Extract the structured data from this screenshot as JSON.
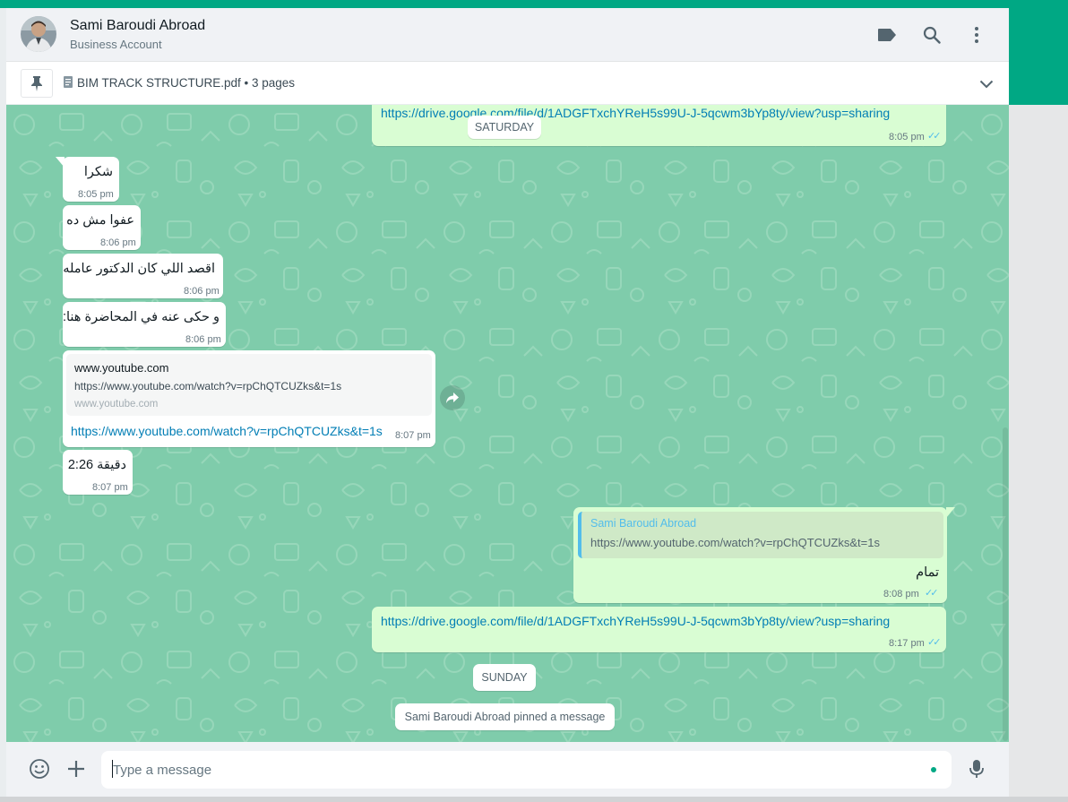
{
  "header": {
    "contact_name": "Sami Baroudi Abroad",
    "contact_subtitle": "Business Account",
    "icons": [
      "label-icon",
      "search-icon",
      "menu-icon"
    ]
  },
  "pinned": {
    "text": "BIM TRACK STRUCTURE.pdf • 3 pages",
    "icons": [
      "pin-icon",
      "document-icon",
      "chevron-down-icon"
    ]
  },
  "messages": {
    "top_link": "https://drive.google.com/file/d/1ADGFTxchYReH5s99U-J-5qcwm3bYp8ty/view?usp=sharing",
    "top_time": "8:05 pm",
    "saturday": "SATURDAY",
    "m1": {
      "text": "شكرا",
      "time": "8:05 pm"
    },
    "m2": {
      "text": "عفوا مش ده",
      "time": "8:06 pm"
    },
    "m3": {
      "text": "اقصد اللي كان الدكتور عامله",
      "time": "8:06 pm"
    },
    "m4": {
      "text": "و حكى عنه في المحاضرة هنا:",
      "time": "8:06 pm"
    },
    "m5": {
      "preview_title": "www.youtube.com",
      "preview_url": "https://www.youtube.com/watch?v=rpChQTCUZks&t=1s",
      "preview_domain": "www.youtube.com",
      "link": "https://www.youtube.com/watch?v=rpChQTCUZks&t=1s",
      "time": "8:07 pm"
    },
    "m6": {
      "text": "دقيقة 2:26",
      "time": "8:07 pm"
    },
    "m7": {
      "quote_author": "Sami Baroudi Abroad",
      "quote_text": "https://www.youtube.com/watch?v=rpChQTCUZks&t=1s",
      "text": "تمام",
      "time": "8:08 pm"
    },
    "m8": {
      "link": "https://drive.google.com/file/d/1ADGFTxchYReH5s99U-J-5qcwm3bYp8ty/view?usp=sharing",
      "time": "8:17 pm"
    },
    "sunday": "SUNDAY",
    "pinned_notice": "Sami Baroudi Abroad pinned a message"
  },
  "footer": {
    "placeholder": "Type a message",
    "icons": [
      "emoji-icon",
      "plus-icon",
      "mic-icon"
    ]
  },
  "colors": {
    "accent": "#00a884",
    "chat_bg": "#7fccab",
    "outgoing": "#d9fdd3",
    "incoming": "#ffffff",
    "link": "#027eb5",
    "read_ticks": "#53bdeb"
  }
}
